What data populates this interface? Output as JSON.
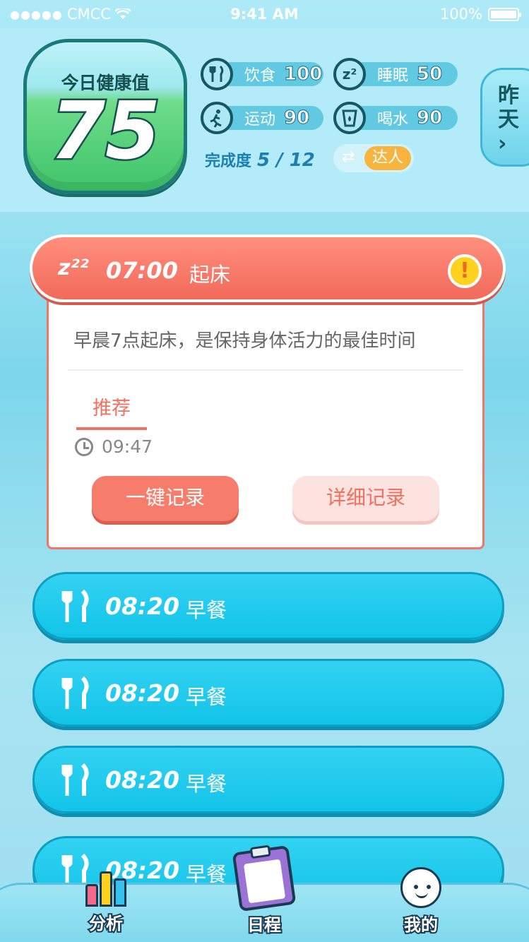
{
  "status_bar": {
    "signal": "●●●●●",
    "carrier": "CMCC",
    "wifi": "wifi-icon",
    "time": "9:41 AM",
    "battery": "100%"
  },
  "header": {
    "score_label": "今日健康值",
    "score_value": "75",
    "stats": [
      {
        "icon": "diet-icon",
        "label": "饮食",
        "value": "100"
      },
      {
        "icon": "sleep-icon",
        "label": "睡眠",
        "value": "50"
      },
      {
        "icon": "exercise-icon",
        "label": "运动",
        "value": "90"
      },
      {
        "icon": "water-icon",
        "label": "喝水",
        "value": "90"
      }
    ],
    "progress_label": "完成度",
    "progress_value": "5 / 12",
    "level_badge": "达人",
    "yesterday_label": "昨天",
    "yesterday_arrow": "›"
  },
  "active_task": {
    "icon_text": "z²²",
    "time": "07:00",
    "title": "起床",
    "alert": "!",
    "description": "早晨7点起床，是保持身体活力的最佳时间",
    "tab_label": "推荐",
    "timestamp": "09:47",
    "quick_record_label": "一键记录",
    "detail_record_label": "详细记录"
  },
  "schedule": [
    {
      "icon": "fork-knife-icon",
      "time": "08:20",
      "title": "早餐"
    },
    {
      "icon": "fork-knife-icon",
      "time": "08:20",
      "title": "早餐"
    },
    {
      "icon": "fork-knife-icon",
      "time": "08:20",
      "title": "早餐"
    },
    {
      "icon": "fork-knife-icon",
      "time": "08:20",
      "title": "早餐"
    }
  ],
  "nav": {
    "analysis": "分析",
    "schedule": "日程",
    "me": "我的"
  },
  "colors": {
    "accent_red": "#f26a5a",
    "row_blue": "#12c4e8",
    "badge_orange": "#f7b540"
  }
}
